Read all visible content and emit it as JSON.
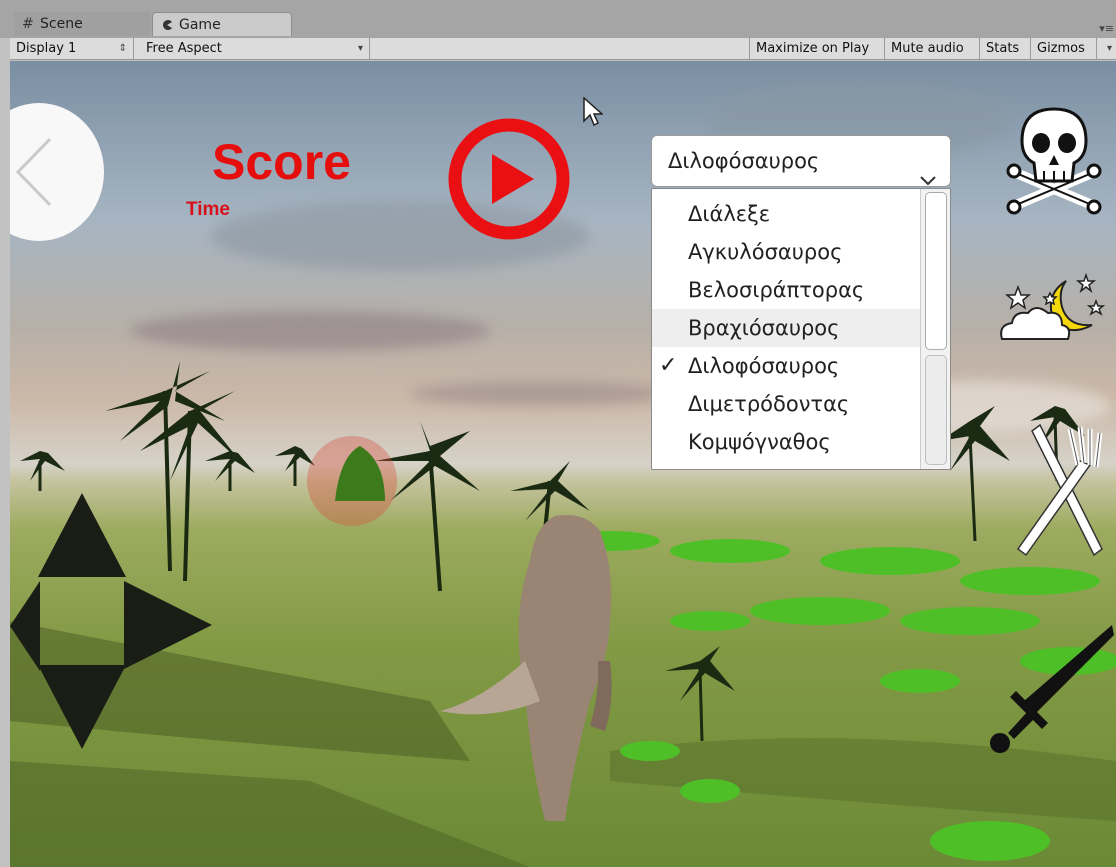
{
  "editor": {
    "tabs": [
      {
        "label": "Scene",
        "icon": "grid-icon"
      },
      {
        "label": "Game",
        "icon": "pacman-icon"
      }
    ],
    "toolbar": {
      "display": "Display 1",
      "aspect": "Free Aspect",
      "maximize_on_play": "Maximize on Play",
      "mute_audio": "Mute audio",
      "stats": "Stats",
      "gizmos": "Gizmos"
    }
  },
  "hud": {
    "score_label": "Score",
    "time_label": "Time",
    "accent_color": "#e60d0d",
    "dropdown": {
      "selected": "Διλοφόσαυρος",
      "options": [
        {
          "label": "Διάλεξε",
          "checked": false
        },
        {
          "label": "Αγκυλόσαυρος",
          "checked": false
        },
        {
          "label": "Βελοσιράπτορας",
          "checked": false
        },
        {
          "label": "Βραχιόσαυρος",
          "checked": false,
          "highlighted": true
        },
        {
          "label": "Διλοφόσαυρος",
          "checked": true
        },
        {
          "label": "Διμετρόδοντας",
          "checked": false
        },
        {
          "label": "Κομψόγναθος",
          "checked": false
        }
      ]
    },
    "right_buttons": [
      "skull-crossbones-icon",
      "night-moon-icon",
      "fork-knife-icon",
      "sword-icon"
    ],
    "dpad": [
      "arrow-up-icon",
      "arrow-left-icon",
      "arrow-right-icon",
      "arrow-down-icon"
    ]
  }
}
